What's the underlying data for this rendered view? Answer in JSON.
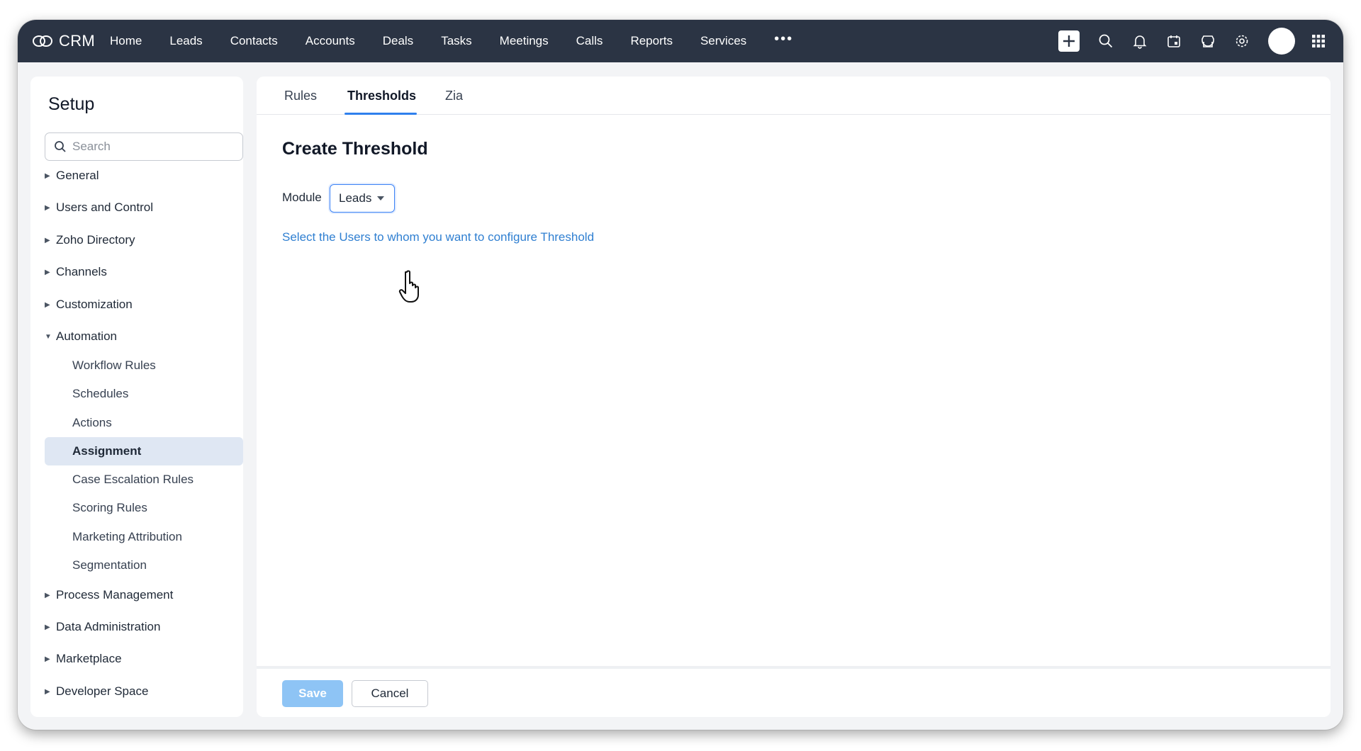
{
  "app": {
    "name": "CRM"
  },
  "nav": {
    "items": [
      "Home",
      "Leads",
      "Contacts",
      "Accounts",
      "Deals",
      "Tasks",
      "Meetings",
      "Calls",
      "Reports",
      "Services"
    ],
    "more": "•••"
  },
  "top_icons": [
    "plus-icon",
    "search-icon",
    "bell-icon",
    "calendar-icon",
    "store-icon",
    "gear-icon",
    "avatar",
    "apps-grid-icon"
  ],
  "sidebar": {
    "title": "Setup",
    "search_placeholder": "Search",
    "sections": [
      "General",
      "Users and Control",
      "Zoho Directory",
      "Channels",
      "Customization",
      "Automation",
      "Process Management",
      "Data Administration",
      "Marketplace",
      "Developer Space"
    ],
    "automation_items": [
      "Workflow Rules",
      "Schedules",
      "Actions",
      "Assignment",
      "Case Escalation Rules",
      "Scoring Rules",
      "Marketing Attribution",
      "Segmentation"
    ],
    "active_item": "Assignment"
  },
  "tabs": [
    "Rules",
    "Thresholds",
    "Zia"
  ],
  "active_tab": "Thresholds",
  "form": {
    "title": "Create Threshold",
    "module_label": "Module",
    "module_value": "Leads",
    "config_link": "Select the Users to whom you want to configure Threshold"
  },
  "footer": {
    "save": "Save",
    "cancel": "Cancel"
  },
  "colors": {
    "topbar": "#2b3444",
    "accent": "#2f80ed",
    "link": "#2f7fd1",
    "active_bg": "#dfe7f3",
    "save_bg": "#8ec4f5"
  }
}
